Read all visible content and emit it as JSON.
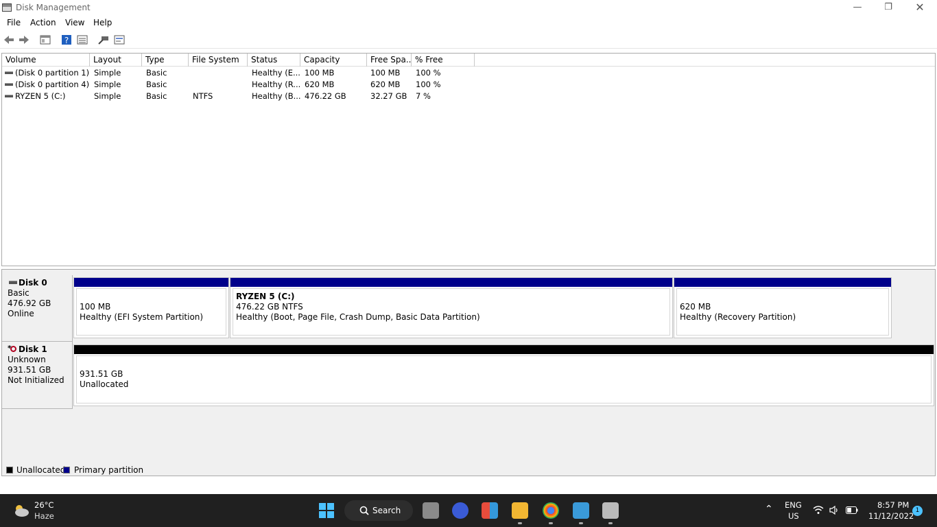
{
  "window": {
    "title": "Disk Management"
  },
  "menu": [
    "File",
    "Action",
    "View",
    "Help"
  ],
  "toolbar": [
    "back-icon",
    "forward-icon",
    "properties-icon",
    "help-icon",
    "list-view-icon",
    "connect-icon",
    "settings-icon"
  ],
  "list": {
    "columns": [
      "Volume",
      "Layout",
      "Type",
      "File System",
      "Status",
      "Capacity",
      "Free Spa...",
      "% Free"
    ],
    "rows": [
      [
        "(Disk 0 partition 1)",
        "Simple",
        "Basic",
        "",
        "Healthy (E...",
        "100 MB",
        "100 MB",
        "100 %"
      ],
      [
        "(Disk 0 partition 4)",
        "Simple",
        "Basic",
        "",
        "Healthy (R...",
        "620 MB",
        "620 MB",
        "100 %"
      ],
      [
        "RYZEN 5 (C:)",
        "Simple",
        "Basic",
        "NTFS",
        "Healthy (B...",
        "476.22 GB",
        "32.27 GB",
        "7 %"
      ]
    ]
  },
  "disks": [
    {
      "name": "Disk 0",
      "type": "Basic",
      "size": "476.92 GB",
      "status": "Online",
      "partitions": [
        {
          "name": "",
          "size": "100 MB",
          "status": "Healthy (EFI System Partition)"
        },
        {
          "name": "RYZEN 5  (C:)",
          "size": "476.22 GB NTFS",
          "status": "Healthy (Boot, Page File, Crash Dump, Basic Data Partition)"
        },
        {
          "name": "",
          "size": "620 MB",
          "status": "Healthy (Recovery Partition)"
        }
      ]
    },
    {
      "name": "Disk 1",
      "marker": "*",
      "type": "Unknown",
      "size": "931.51 GB",
      "status": "Not Initialized",
      "partitions": [
        {
          "size": "931.51 GB",
          "status": "Unallocated"
        }
      ]
    }
  ],
  "legend": {
    "unallocated": "Unallocated",
    "primary": "Primary partition"
  },
  "colors": {
    "primary_partition": "#00008b",
    "unallocated": "#000000"
  },
  "taskbar": {
    "weather": {
      "temp": "26°C",
      "condition": "Haze"
    },
    "search_label": "Search",
    "language": {
      "lang": "ENG",
      "region": "US"
    },
    "time": "8:57 PM",
    "date": "11/12/2022",
    "notifications": "1"
  }
}
